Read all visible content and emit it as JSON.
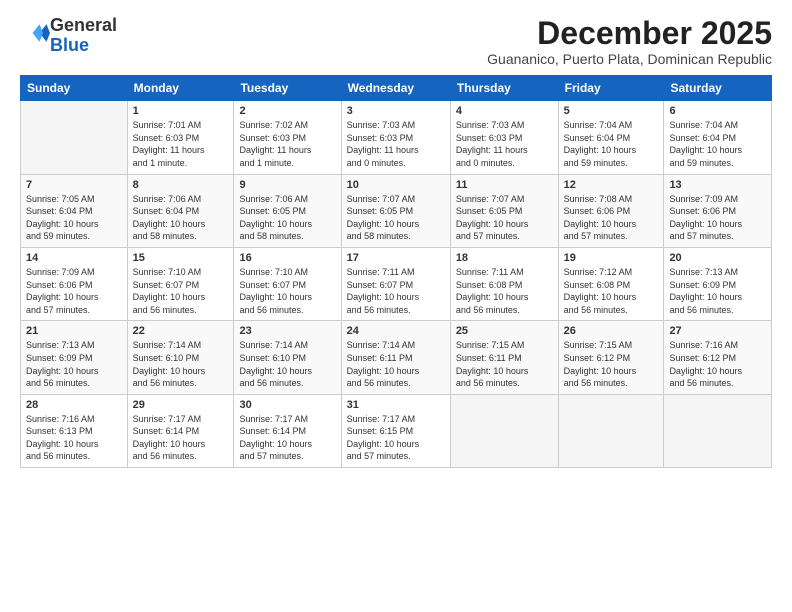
{
  "logo": {
    "general": "General",
    "blue": "Blue"
  },
  "header": {
    "title": "December 2025",
    "subtitle": "Guananico, Puerto Plata, Dominican Republic"
  },
  "weekdays": [
    "Sunday",
    "Monday",
    "Tuesday",
    "Wednesday",
    "Thursday",
    "Friday",
    "Saturday"
  ],
  "weeks": [
    [
      {
        "day": "",
        "info": ""
      },
      {
        "day": "1",
        "info": "Sunrise: 7:01 AM\nSunset: 6:03 PM\nDaylight: 11 hours\nand 1 minute."
      },
      {
        "day": "2",
        "info": "Sunrise: 7:02 AM\nSunset: 6:03 PM\nDaylight: 11 hours\nand 1 minute."
      },
      {
        "day": "3",
        "info": "Sunrise: 7:03 AM\nSunset: 6:03 PM\nDaylight: 11 hours\nand 0 minutes."
      },
      {
        "day": "4",
        "info": "Sunrise: 7:03 AM\nSunset: 6:03 PM\nDaylight: 11 hours\nand 0 minutes."
      },
      {
        "day": "5",
        "info": "Sunrise: 7:04 AM\nSunset: 6:04 PM\nDaylight: 10 hours\nand 59 minutes."
      },
      {
        "day": "6",
        "info": "Sunrise: 7:04 AM\nSunset: 6:04 PM\nDaylight: 10 hours\nand 59 minutes."
      }
    ],
    [
      {
        "day": "7",
        "info": "Sunrise: 7:05 AM\nSunset: 6:04 PM\nDaylight: 10 hours\nand 59 minutes."
      },
      {
        "day": "8",
        "info": "Sunrise: 7:06 AM\nSunset: 6:04 PM\nDaylight: 10 hours\nand 58 minutes."
      },
      {
        "day": "9",
        "info": "Sunrise: 7:06 AM\nSunset: 6:05 PM\nDaylight: 10 hours\nand 58 minutes."
      },
      {
        "day": "10",
        "info": "Sunrise: 7:07 AM\nSunset: 6:05 PM\nDaylight: 10 hours\nand 58 minutes."
      },
      {
        "day": "11",
        "info": "Sunrise: 7:07 AM\nSunset: 6:05 PM\nDaylight: 10 hours\nand 57 minutes."
      },
      {
        "day": "12",
        "info": "Sunrise: 7:08 AM\nSunset: 6:06 PM\nDaylight: 10 hours\nand 57 minutes."
      },
      {
        "day": "13",
        "info": "Sunrise: 7:09 AM\nSunset: 6:06 PM\nDaylight: 10 hours\nand 57 minutes."
      }
    ],
    [
      {
        "day": "14",
        "info": "Sunrise: 7:09 AM\nSunset: 6:06 PM\nDaylight: 10 hours\nand 57 minutes."
      },
      {
        "day": "15",
        "info": "Sunrise: 7:10 AM\nSunset: 6:07 PM\nDaylight: 10 hours\nand 56 minutes."
      },
      {
        "day": "16",
        "info": "Sunrise: 7:10 AM\nSunset: 6:07 PM\nDaylight: 10 hours\nand 56 minutes."
      },
      {
        "day": "17",
        "info": "Sunrise: 7:11 AM\nSunset: 6:07 PM\nDaylight: 10 hours\nand 56 minutes."
      },
      {
        "day": "18",
        "info": "Sunrise: 7:11 AM\nSunset: 6:08 PM\nDaylight: 10 hours\nand 56 minutes."
      },
      {
        "day": "19",
        "info": "Sunrise: 7:12 AM\nSunset: 6:08 PM\nDaylight: 10 hours\nand 56 minutes."
      },
      {
        "day": "20",
        "info": "Sunrise: 7:13 AM\nSunset: 6:09 PM\nDaylight: 10 hours\nand 56 minutes."
      }
    ],
    [
      {
        "day": "21",
        "info": "Sunrise: 7:13 AM\nSunset: 6:09 PM\nDaylight: 10 hours\nand 56 minutes."
      },
      {
        "day": "22",
        "info": "Sunrise: 7:14 AM\nSunset: 6:10 PM\nDaylight: 10 hours\nand 56 minutes."
      },
      {
        "day": "23",
        "info": "Sunrise: 7:14 AM\nSunset: 6:10 PM\nDaylight: 10 hours\nand 56 minutes."
      },
      {
        "day": "24",
        "info": "Sunrise: 7:14 AM\nSunset: 6:11 PM\nDaylight: 10 hours\nand 56 minutes."
      },
      {
        "day": "25",
        "info": "Sunrise: 7:15 AM\nSunset: 6:11 PM\nDaylight: 10 hours\nand 56 minutes."
      },
      {
        "day": "26",
        "info": "Sunrise: 7:15 AM\nSunset: 6:12 PM\nDaylight: 10 hours\nand 56 minutes."
      },
      {
        "day": "27",
        "info": "Sunrise: 7:16 AM\nSunset: 6:12 PM\nDaylight: 10 hours\nand 56 minutes."
      }
    ],
    [
      {
        "day": "28",
        "info": "Sunrise: 7:16 AM\nSunset: 6:13 PM\nDaylight: 10 hours\nand 56 minutes."
      },
      {
        "day": "29",
        "info": "Sunrise: 7:17 AM\nSunset: 6:14 PM\nDaylight: 10 hours\nand 56 minutes."
      },
      {
        "day": "30",
        "info": "Sunrise: 7:17 AM\nSunset: 6:14 PM\nDaylight: 10 hours\nand 57 minutes."
      },
      {
        "day": "31",
        "info": "Sunrise: 7:17 AM\nSunset: 6:15 PM\nDaylight: 10 hours\nand 57 minutes."
      },
      {
        "day": "",
        "info": ""
      },
      {
        "day": "",
        "info": ""
      },
      {
        "day": "",
        "info": ""
      }
    ]
  ]
}
